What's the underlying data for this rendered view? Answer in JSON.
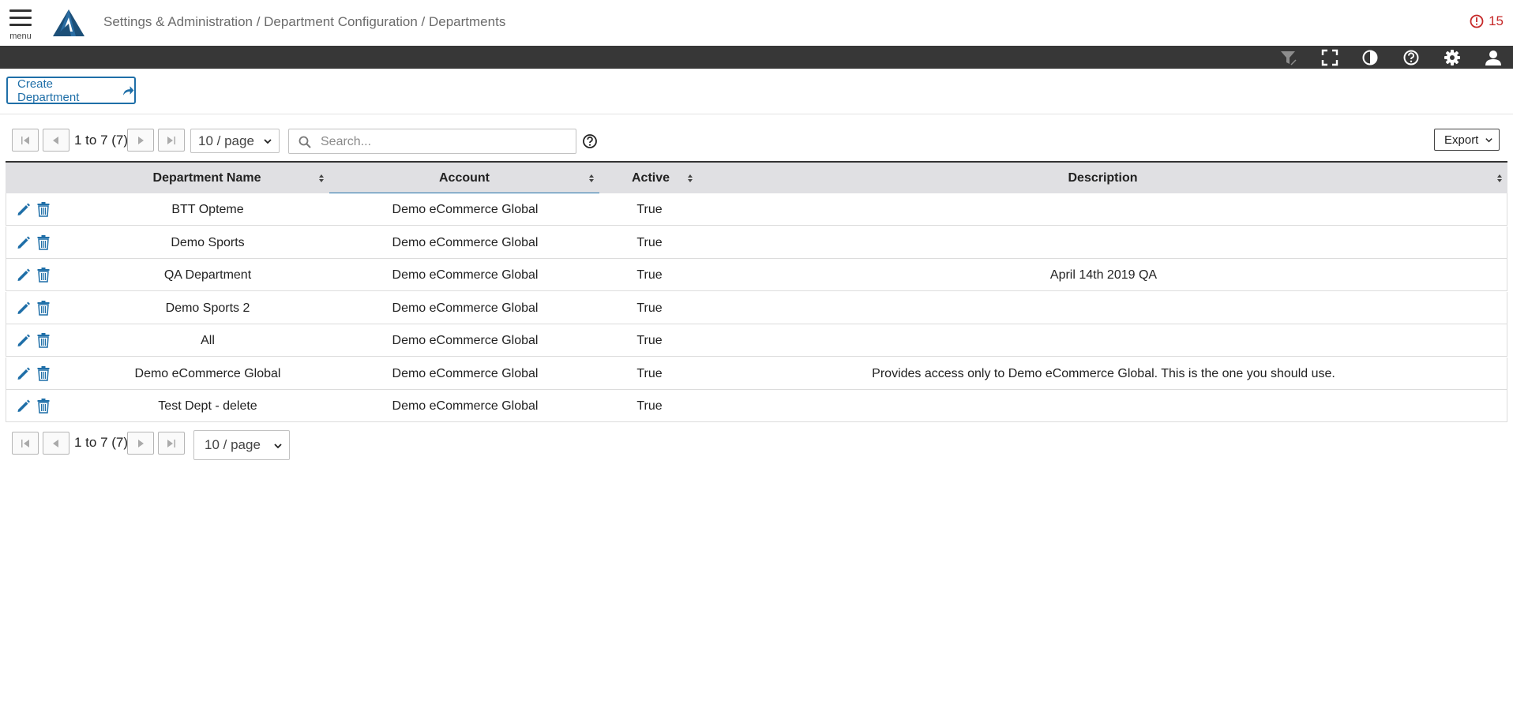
{
  "header": {
    "menu_label": "menu",
    "breadcrumb": [
      "Settings & Administration",
      "Department Configuration",
      "Departments"
    ],
    "breadcrumb_sep": " / ",
    "alert_count": "15",
    "alert_color": "#c62828"
  },
  "toolbar": {
    "icons": [
      "filter-icon",
      "fullscreen-icon",
      "contrast-icon",
      "help-icon",
      "gear-icon",
      "user-icon"
    ]
  },
  "actions": {
    "create_label": "Create Department"
  },
  "pager_top": {
    "range_text": "1 to 7 (7)",
    "page_size": "10 / page"
  },
  "pager_bottom": {
    "range_text": "1 to 7 (7)",
    "page_size": "10 / page"
  },
  "search": {
    "placeholder": "Search...",
    "value": ""
  },
  "export": {
    "label": "Export"
  },
  "table": {
    "columns": [
      "Department Name",
      "Account",
      "Active",
      "Description"
    ],
    "rows": [
      {
        "name": "BTT Opteme",
        "account": "Demo eCommerce Global",
        "active": "True",
        "description": ""
      },
      {
        "name": "Demo Sports",
        "account": "Demo eCommerce Global",
        "active": "True",
        "description": ""
      },
      {
        "name": "QA Department",
        "account": "Demo eCommerce Global",
        "active": "True",
        "description": "April 14th 2019 QA"
      },
      {
        "name": "Demo Sports 2",
        "account": "Demo eCommerce Global",
        "active": "True",
        "description": ""
      },
      {
        "name": "All",
        "account": "Demo eCommerce Global",
        "active": "True",
        "description": ""
      },
      {
        "name": "Demo eCommerce Global",
        "account": "Demo eCommerce Global",
        "active": "True",
        "description": "Provides access only to Demo eCommerce Global. This is the one you should use."
      },
      {
        "name": "Test Dept - delete",
        "account": "Demo eCommerce Global",
        "active": "True",
        "description": ""
      }
    ]
  },
  "colors": {
    "accent": "#1f6fa8",
    "toolbar_bg": "#373737",
    "header_row_bg": "#e0e0e3"
  }
}
